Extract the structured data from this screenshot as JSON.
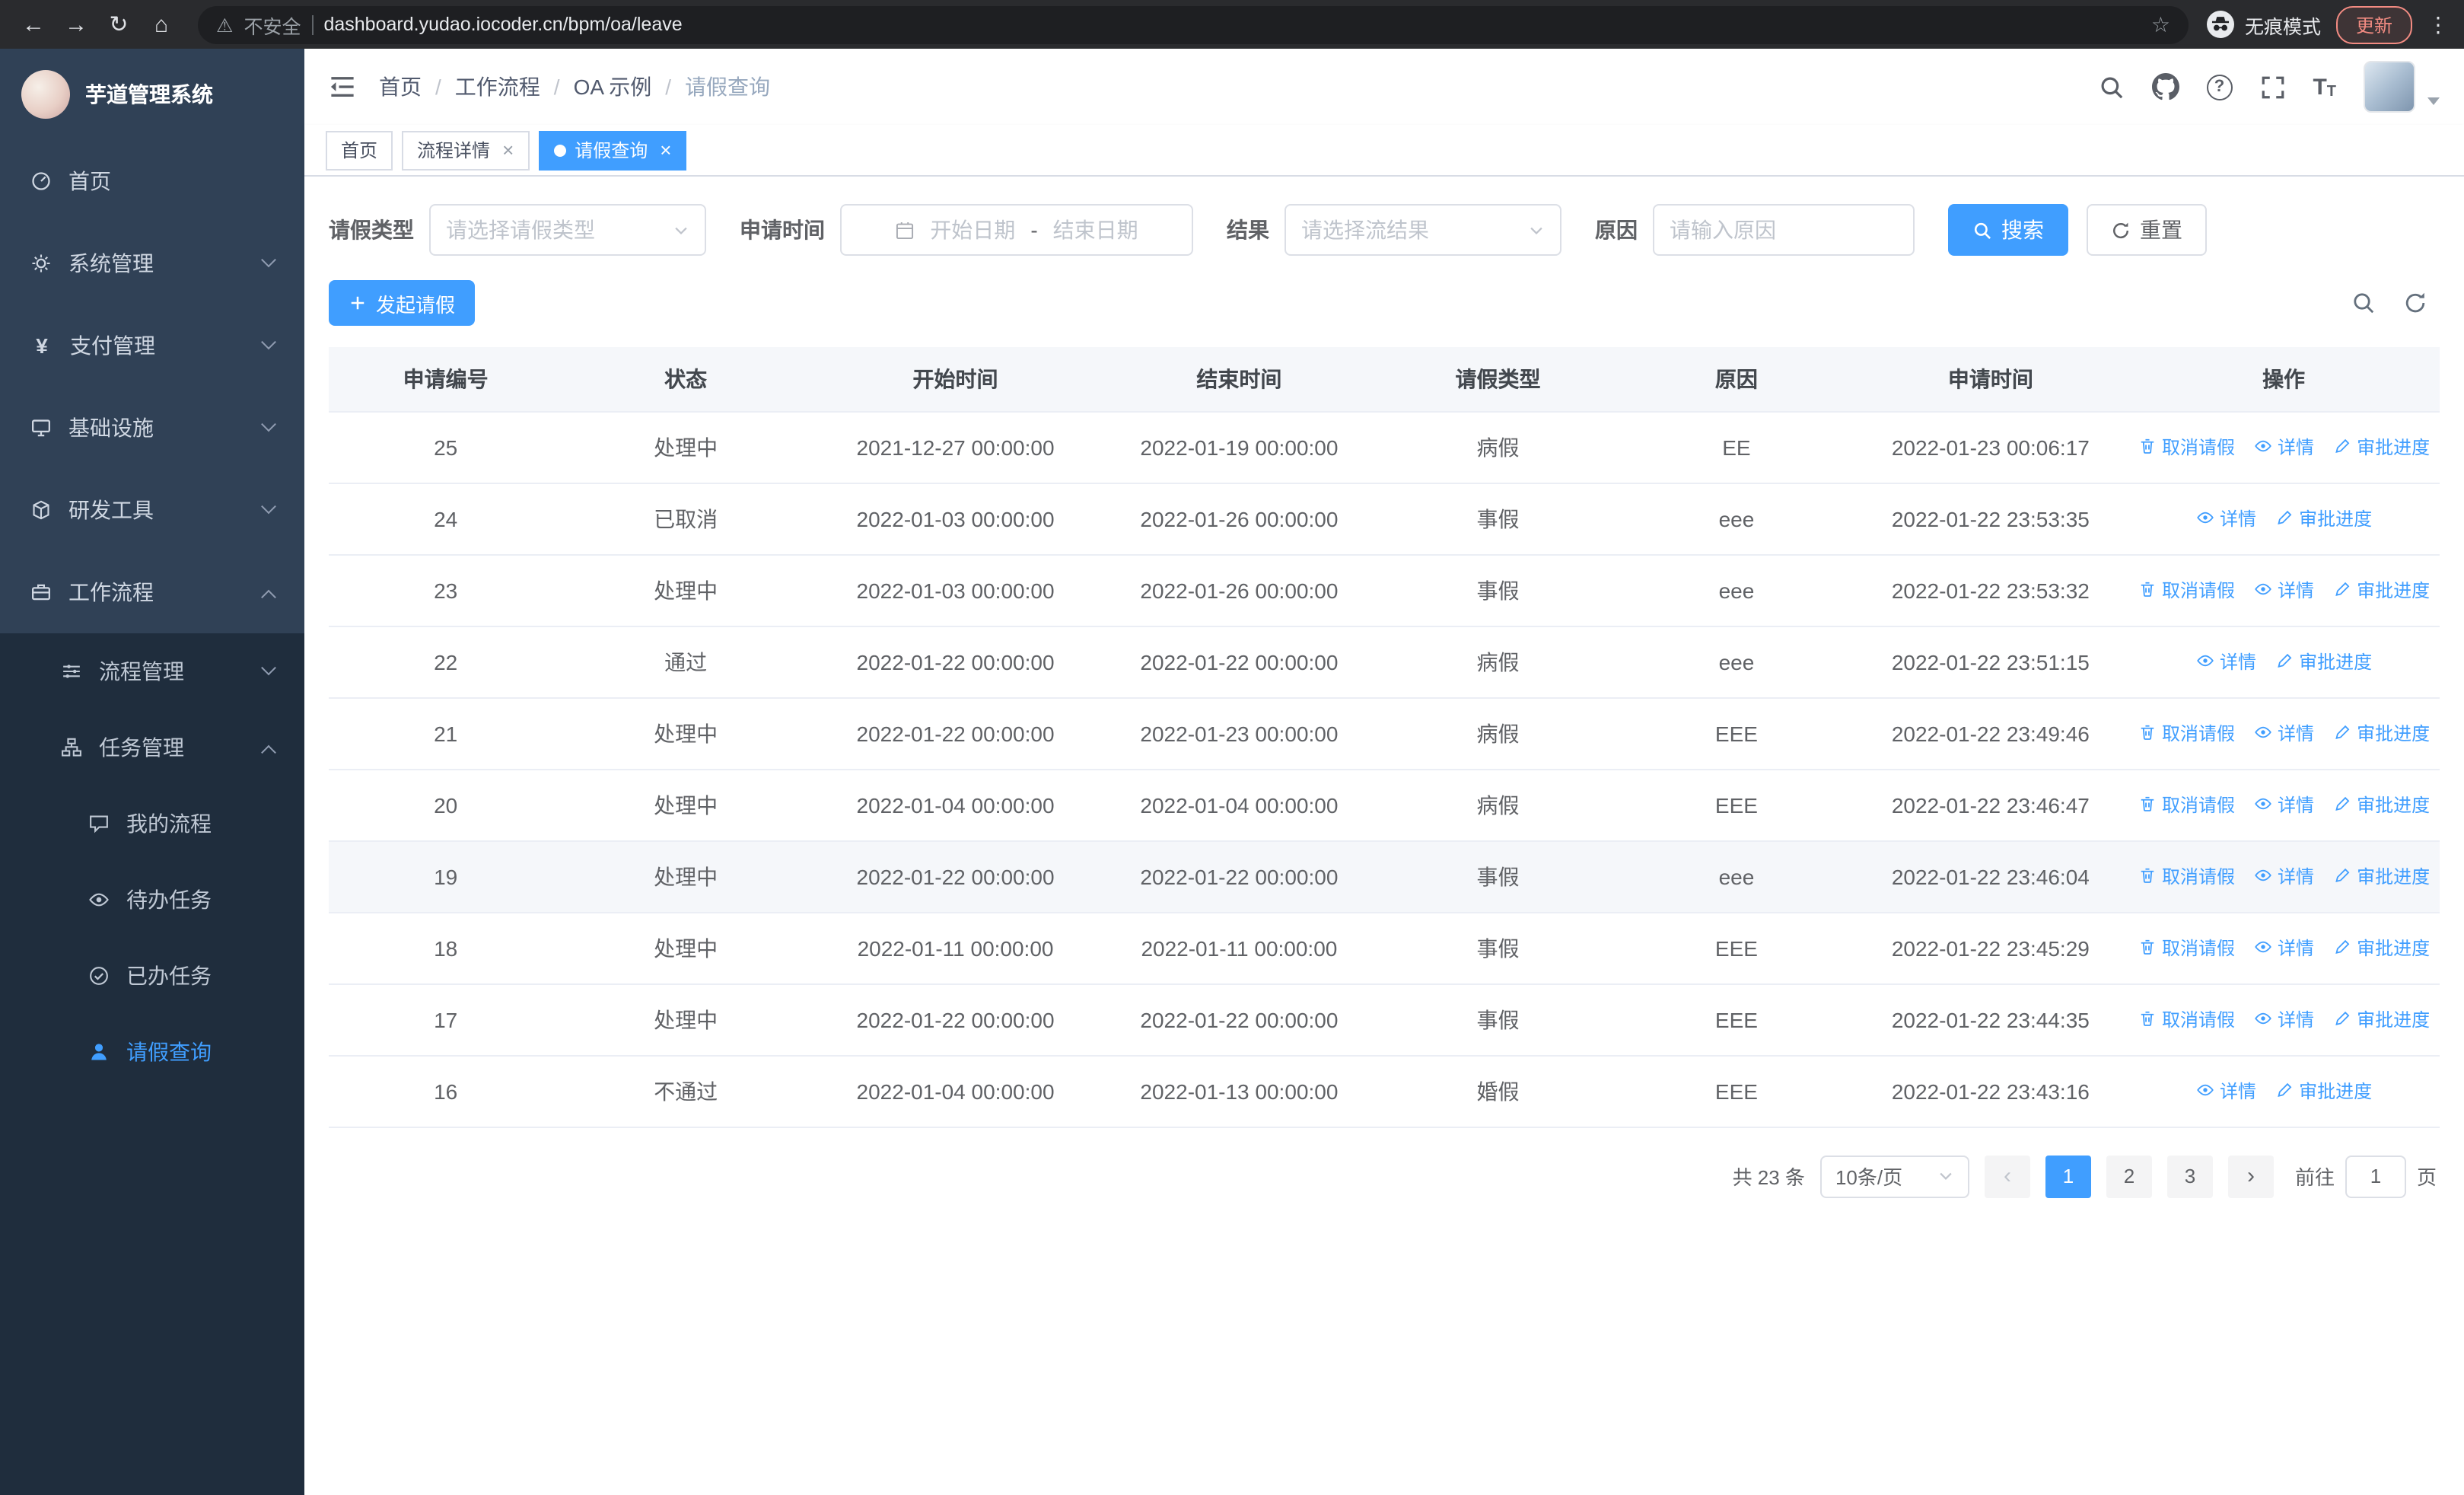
{
  "colors": {
    "accent": "#409EFF",
    "sidebar_bg": "#304156",
    "sidebar_sub_bg": "#1f2d3d"
  },
  "browser": {
    "security_label": "不安全",
    "url": "dashboard.yudao.iocoder.cn/bpm/oa/leave",
    "incognito_label": "无痕模式",
    "update_label": "更新"
  },
  "sidebar": {
    "logo_title": "芋道管理系统",
    "menu": [
      {
        "label": "首页"
      },
      {
        "label": "系统管理"
      },
      {
        "label": "支付管理"
      },
      {
        "label": "基础设施"
      },
      {
        "label": "研发工具"
      },
      {
        "label": "工作流程"
      },
      {
        "label": "流程管理"
      },
      {
        "label": "任务管理"
      },
      {
        "label": "我的流程"
      },
      {
        "label": "待办任务"
      },
      {
        "label": "已办任务"
      },
      {
        "label": "请假查询"
      }
    ]
  },
  "header": {
    "breadcrumb": [
      "首页",
      "工作流程",
      "OA 示例",
      "请假查询"
    ],
    "breadcrumb_separator": "/"
  },
  "tabs": [
    {
      "label": "首页",
      "closable": false,
      "active": false
    },
    {
      "label": "流程详情",
      "closable": true,
      "active": false
    },
    {
      "label": "请假查询",
      "closable": true,
      "active": true
    }
  ],
  "filters": {
    "leave_type_label": "请假类型",
    "leave_type_placeholder": "请选择请假类型",
    "apply_time_label": "申请时间",
    "date_start_placeholder": "开始日期",
    "date_separator": "-",
    "date_end_placeholder": "结束日期",
    "result_label": "结果",
    "result_placeholder": "请选择流结果",
    "reason_label": "原因",
    "reason_placeholder": "请输入原因",
    "search_label": "搜索",
    "reset_label": "重置"
  },
  "toolbar": {
    "create_label": "发起请假"
  },
  "table": {
    "headers": [
      "申请编号",
      "状态",
      "开始时间",
      "结束时间",
      "请假类型",
      "原因",
      "申请时间",
      "操作"
    ],
    "action_labels": {
      "cancel": "取消请假",
      "detail": "详情",
      "progress": "审批进度"
    },
    "rows": [
      {
        "id": "25",
        "status": "处理中",
        "start": "2021-12-27 00:00:00",
        "end": "2022-01-19 00:00:00",
        "type": "病假",
        "reason": "EE",
        "applied": "2022-01-23 00:06:17",
        "actions": [
          "cancel",
          "detail",
          "progress"
        ],
        "highlight": false
      },
      {
        "id": "24",
        "status": "已取消",
        "start": "2022-01-03 00:00:00",
        "end": "2022-01-26 00:00:00",
        "type": "事假",
        "reason": "eee",
        "applied": "2022-01-22 23:53:35",
        "actions": [
          "detail",
          "progress"
        ],
        "highlight": false
      },
      {
        "id": "23",
        "status": "处理中",
        "start": "2022-01-03 00:00:00",
        "end": "2022-01-26 00:00:00",
        "type": "事假",
        "reason": "eee",
        "applied": "2022-01-22 23:53:32",
        "actions": [
          "cancel",
          "detail",
          "progress"
        ],
        "highlight": false
      },
      {
        "id": "22",
        "status": "通过",
        "start": "2022-01-22 00:00:00",
        "end": "2022-01-22 00:00:00",
        "type": "病假",
        "reason": "eee",
        "applied": "2022-01-22 23:51:15",
        "actions": [
          "detail",
          "progress"
        ],
        "highlight": false
      },
      {
        "id": "21",
        "status": "处理中",
        "start": "2022-01-22 00:00:00",
        "end": "2022-01-23 00:00:00",
        "type": "病假",
        "reason": "EEE",
        "applied": "2022-01-22 23:49:46",
        "actions": [
          "cancel",
          "detail",
          "progress"
        ],
        "highlight": false
      },
      {
        "id": "20",
        "status": "处理中",
        "start": "2022-01-04 00:00:00",
        "end": "2022-01-04 00:00:00",
        "type": "病假",
        "reason": "EEE",
        "applied": "2022-01-22 23:46:47",
        "actions": [
          "cancel",
          "detail",
          "progress"
        ],
        "highlight": false
      },
      {
        "id": "19",
        "status": "处理中",
        "start": "2022-01-22 00:00:00",
        "end": "2022-01-22 00:00:00",
        "type": "事假",
        "reason": "eee",
        "applied": "2022-01-22 23:46:04",
        "actions": [
          "cancel",
          "detail",
          "progress"
        ],
        "highlight": true
      },
      {
        "id": "18",
        "status": "处理中",
        "start": "2022-01-11 00:00:00",
        "end": "2022-01-11 00:00:00",
        "type": "事假",
        "reason": "EEE",
        "applied": "2022-01-22 23:45:29",
        "actions": [
          "cancel",
          "detail",
          "progress"
        ],
        "highlight": false
      },
      {
        "id": "17",
        "status": "处理中",
        "start": "2022-01-22 00:00:00",
        "end": "2022-01-22 00:00:00",
        "type": "事假",
        "reason": "EEE",
        "applied": "2022-01-22 23:44:35",
        "actions": [
          "cancel",
          "detail",
          "progress"
        ],
        "highlight": false
      },
      {
        "id": "16",
        "status": "不通过",
        "start": "2022-01-04 00:00:00",
        "end": "2022-01-13 00:00:00",
        "type": "婚假",
        "reason": "EEE",
        "applied": "2022-01-22 23:43:16",
        "actions": [
          "detail",
          "progress"
        ],
        "highlight": false
      }
    ]
  },
  "pagination": {
    "total_label": "共 23 条",
    "page_size_label": "10条/页",
    "pages": [
      "1",
      "2",
      "3"
    ],
    "active_page": "1",
    "jump_label": "前往",
    "jump_value": "1",
    "jump_unit_label": "页"
  }
}
